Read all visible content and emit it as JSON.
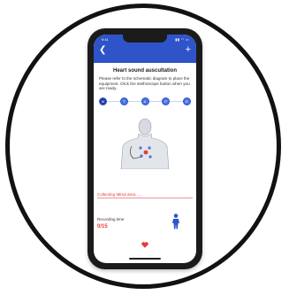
{
  "status_bar": {
    "time": "9:41",
    "icons": "▮▮ ◠ ▭"
  },
  "app_bar": {
    "back_symbol": "❮",
    "add_symbol": "+"
  },
  "page": {
    "title": "Heart sound auscultation",
    "instruction": "Please refer to the schematic diagram to place the equipment. Click the stethoscope button when you are ready."
  },
  "steps": [
    "M",
    "T",
    "A",
    "P",
    "E"
  ],
  "status": {
    "collecting": "Collecting Mitral area......"
  },
  "recording": {
    "label": "Recording time",
    "value": "0/15"
  },
  "colors": {
    "accent": "#2f54c9",
    "alert": "#e33b3b"
  }
}
